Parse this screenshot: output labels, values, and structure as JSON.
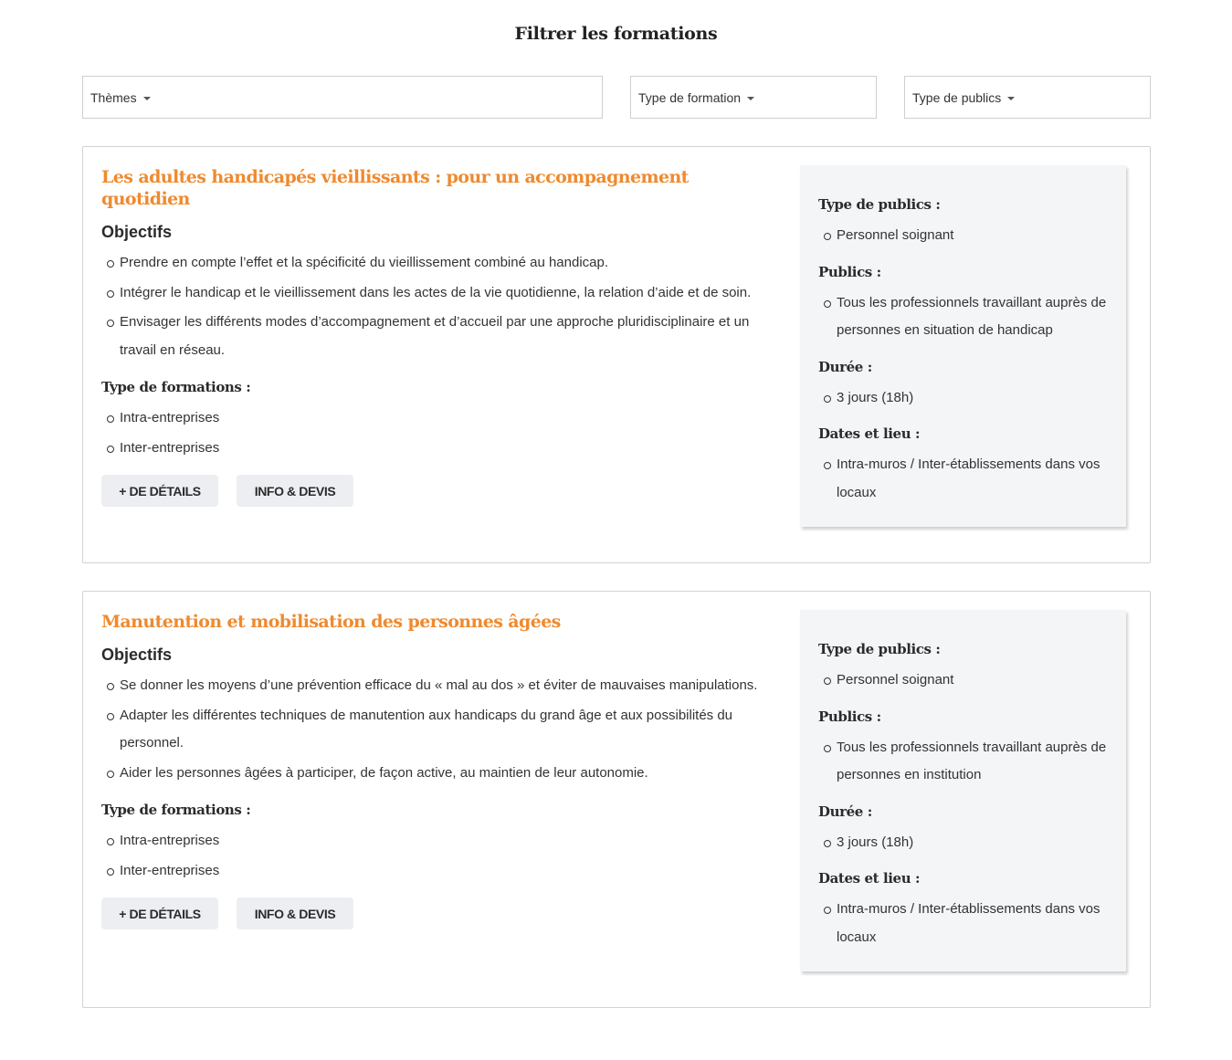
{
  "page": {
    "title": "Filtrer les formations"
  },
  "filters": {
    "themes": "Thèmes",
    "type_formation": "Type de formation",
    "type_publics": "Type de publics"
  },
  "colors": {
    "accent": "#ef8a2e",
    "panel_bg": "#f4f5f7",
    "button_bg": "#eceef2"
  },
  "labels": {
    "objectifs": "Objectifs",
    "type_formations": "Type de formations :",
    "type_publics": "Type de publics :",
    "publics": "Publics :",
    "duree": "Durée :",
    "dates_lieu": "Dates et lieu :",
    "details_button": "+ DE DÉTAILS",
    "devis_button": "INFO & DEVIS"
  },
  "formations": [
    {
      "title": "Les adultes handicapés vieillissants : pour un accompagnement quotidien",
      "objectifs": [
        "Prendre en compte l’effet et la spécificité du vieillissement combiné au handicap.",
        "Intégrer le handicap et le vieillissement dans les actes de la vie quotidienne, la relation d’aide et de soin.",
        "Envisager les différents modes d’accompagnement et d’accueil par une approche pluridisciplinaire et un travail en réseau."
      ],
      "type_formations": [
        "Intra-entreprises",
        "Inter-entreprises"
      ],
      "type_publics": [
        "Personnel soignant"
      ],
      "publics": [
        "Tous les professionnels travaillant auprès de personnes en situation de handicap"
      ],
      "duree": [
        "3 jours (18h)"
      ],
      "dates_lieu": [
        "Intra-muros / Inter-établissements dans vos locaux"
      ]
    },
    {
      "title": "Manutention et mobilisation des personnes âgées",
      "objectifs": [
        "Se donner les moyens d’une prévention efficace du « mal au dos » et éviter de mauvaises manipulations.",
        "Adapter les différentes techniques de manutention aux handicaps du grand âge et aux possibilités du personnel.",
        "Aider les personnes âgées à participer, de façon active, au maintien de leur autonomie."
      ],
      "type_formations": [
        "Intra-entreprises",
        "Inter-entreprises"
      ],
      "type_publics": [
        "Personnel soignant"
      ],
      "publics": [
        "Tous les professionnels travaillant auprès de personnes en institution"
      ],
      "duree": [
        "3 jours (18h)"
      ],
      "dates_lieu": [
        "Intra-muros / Inter-établissements dans vos locaux"
      ]
    }
  ]
}
